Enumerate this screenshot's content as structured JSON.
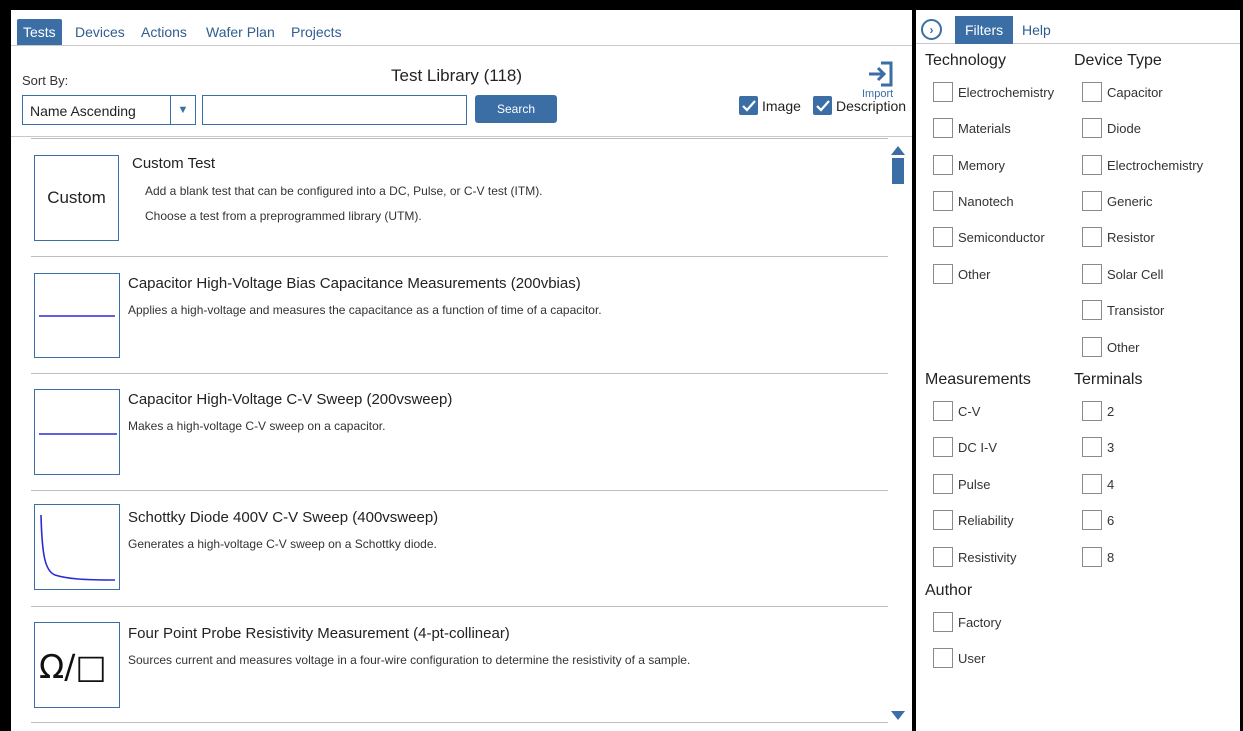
{
  "nav": {
    "tabs": [
      "Tests",
      "Devices",
      "Actions",
      "Wafer Plan",
      "Projects"
    ],
    "active": "Tests"
  },
  "toolbar": {
    "sort_label": "Sort By:",
    "sort_value": "Name Ascending",
    "search_value": "",
    "search_button": "Search",
    "library_title": "Test Library (118)",
    "import_label": "Import",
    "image_label": "Image",
    "image_checked": true,
    "description_label": "Description",
    "description_checked": true
  },
  "tests": [
    {
      "title": "Custom Test",
      "thumb_text": "Custom",
      "desc1": "Add a blank test that can be configured into a DC, Pulse, or C-V test (ITM).",
      "desc2": "Choose a test from a preprogrammed library (UTM)."
    },
    {
      "title": "Capacitor High-Voltage Bias Capacitance Measurements (200vbias)",
      "desc1": "Applies a high-voltage and measures the capacitance as a function of time of a capacitor."
    },
    {
      "title": "Capacitor High-Voltage C-V Sweep (200vsweep)",
      "desc1": "Makes a high-voltage C-V sweep on a capacitor."
    },
    {
      "title": "Schottky Diode 400V C-V Sweep (400vsweep)",
      "desc1": "Generates a high-voltage C-V sweep on a Schottky diode."
    },
    {
      "title": "Four Point Probe Resistivity Measurement (4-pt-collinear)",
      "thumb_text": "Ω/□",
      "desc1": "Sources current and measures voltage in a four-wire configuration to determine the resistivity of a sample."
    }
  ],
  "panel": {
    "tabs": [
      "Filters",
      "Help"
    ],
    "active": "Filters",
    "technology": {
      "title": "Technology",
      "items": [
        "Electrochemistry",
        "Materials",
        "Memory",
        "Nanotech",
        "Semiconductor",
        "Other"
      ]
    },
    "device_type": {
      "title": "Device Type",
      "items": [
        "Capacitor",
        "Diode",
        "Electrochemistry",
        "Generic",
        "Resistor",
        "Solar Cell",
        "Transistor",
        "Other"
      ]
    },
    "measurements": {
      "title": "Measurements",
      "items": [
        "C-V",
        "DC I-V",
        "Pulse",
        "Reliability",
        "Resistivity"
      ]
    },
    "terminals": {
      "title": "Terminals",
      "items": [
        "2",
        "3",
        "4",
        "6",
        "8"
      ]
    },
    "author": {
      "title": "Author",
      "items": [
        "Factory",
        "User"
      ]
    }
  },
  "colors": {
    "accent": "#3a6ea5",
    "trace": "#2b2bd6"
  }
}
